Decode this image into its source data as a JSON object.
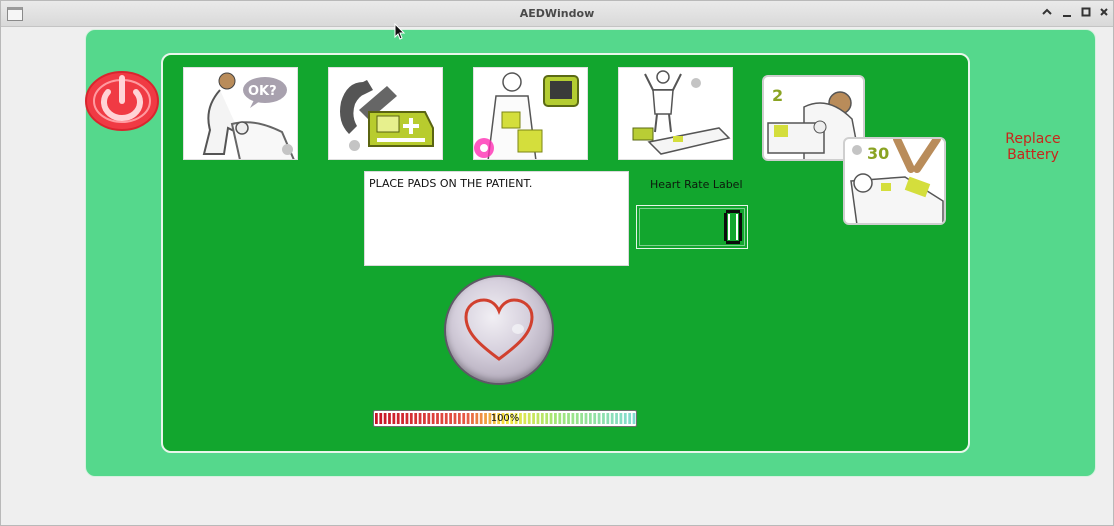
{
  "window": {
    "title": "AEDWindow",
    "controls": {
      "collapse": "^",
      "minimize": "_",
      "maximize": "▫",
      "close": "×"
    }
  },
  "power_button": {
    "icon": "power-icon",
    "color": "#f0303a"
  },
  "steps": [
    {
      "name": "check-responsiveness",
      "icon": "responsiveness-icon",
      "bubble_text": "OK?"
    },
    {
      "name": "call-emergency",
      "icon": "ambulance-phone-icon"
    },
    {
      "name": "attach-pads",
      "icon": "attach-pads-icon"
    },
    {
      "name": "stand-clear",
      "icon": "stand-clear-icon"
    }
  ],
  "cpr": {
    "breaths": "2",
    "compressions": "30"
  },
  "message": {
    "text": "PLACE PADS ON THE PATIENT."
  },
  "heart_rate": {
    "label": "Heart Rate Label",
    "value": "0"
  },
  "battery": {
    "level": 100,
    "text": "100%",
    "warning": "Replace Battery"
  },
  "shock_button": {
    "icon": "heart-icon"
  },
  "colors": {
    "outer_panel": "#55d88c",
    "inner_panel": "#12a62e",
    "warning_text": "#c8261b",
    "heart_stroke": "#d1402e"
  }
}
